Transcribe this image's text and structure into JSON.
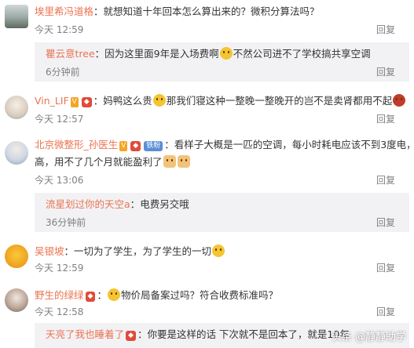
{
  "comments": [
    {
      "user": "埃里希冯道格",
      "sep": "：",
      "text": "就想知道十年回本怎么算出来的？微积分算法吗？",
      "time": "今天 12:59",
      "reply": "回复",
      "nested": {
        "user": "瞿云意tree",
        "sep": "：",
        "text_before": "因为这里面9年是入场费啊",
        "text_after": "不然公司进不了学校搞共享空调",
        "time": "6分钟前",
        "reply": "回复"
      }
    },
    {
      "user": "Vin_LIF",
      "text_before": "妈鸭这么贵",
      "text_after": "那我们寝这种一整晚一整晚开的岂不是卖肾都用不起",
      "time": "今天 12:57",
      "reply": "回复"
    },
    {
      "user": "北京微整形_孙医生",
      "badge_fan": "铁粉",
      "text_line1": "看样子大概是一匹的空调，每小时耗电应该不到3度电，利润挺",
      "text_line2": "高，用不了几个月就能盈利了",
      "time": "今天 13:06",
      "reply": "回复",
      "nested": {
        "user": "流星划过你的天空a",
        "sep": "：",
        "text": "电费另交哦",
        "time": "36分钟前",
        "reply": "回复"
      }
    },
    {
      "user": "吴银坡",
      "sep": "：",
      "text": "一切为了学生，为了学生的一切",
      "time": "今天 12:59",
      "reply": "回复"
    },
    {
      "user": "野生的绿绿",
      "text": "物价局备案过吗？符合收费标准吗？",
      "time": "今天 12:58",
      "reply": "回复",
      "nested": {
        "user": "天亮了我也睡着了",
        "sep": "：",
        "text": "你要是这样的话  下次就不是回本了，就是10年"
      }
    }
  ],
  "watermark": "头条 @静静助学"
}
